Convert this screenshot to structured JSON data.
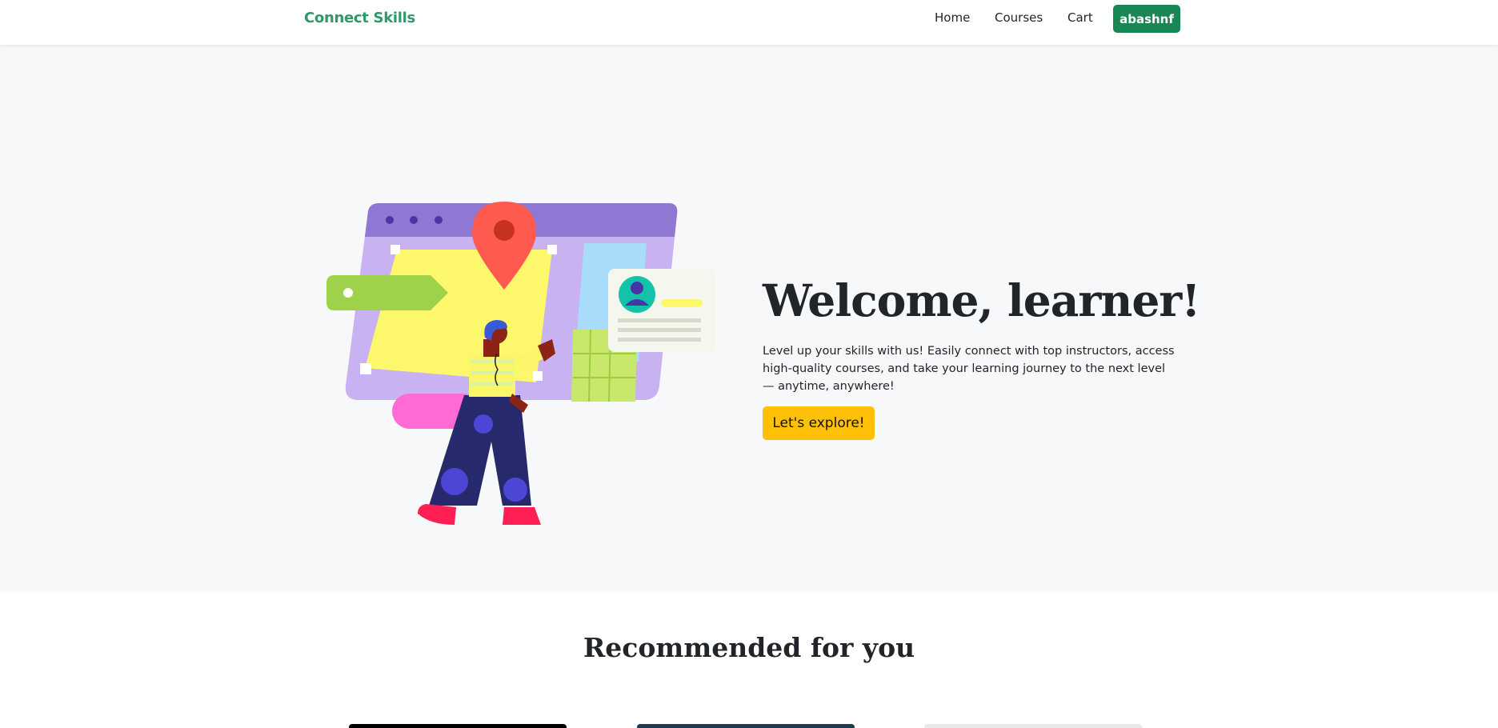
{
  "navbar": {
    "brand": "Connect Skills",
    "links": {
      "home": "Home",
      "courses": "Courses",
      "cart": "Cart"
    },
    "user_button": "abashnf"
  },
  "hero": {
    "title": "Welcome, learner!",
    "description": "Level up your skills with us! Easily connect with top instructors, access high-quality courses, and take your learning journey to the next level — anytime, anywhere!",
    "cta": "Let's explore!"
  },
  "recommended": {
    "title": "Recommended for you"
  },
  "colors": {
    "brand": "#2e9a68",
    "user_button": "#198754",
    "cta": "#ffc107",
    "hero_bg": "#f7f8f9"
  }
}
